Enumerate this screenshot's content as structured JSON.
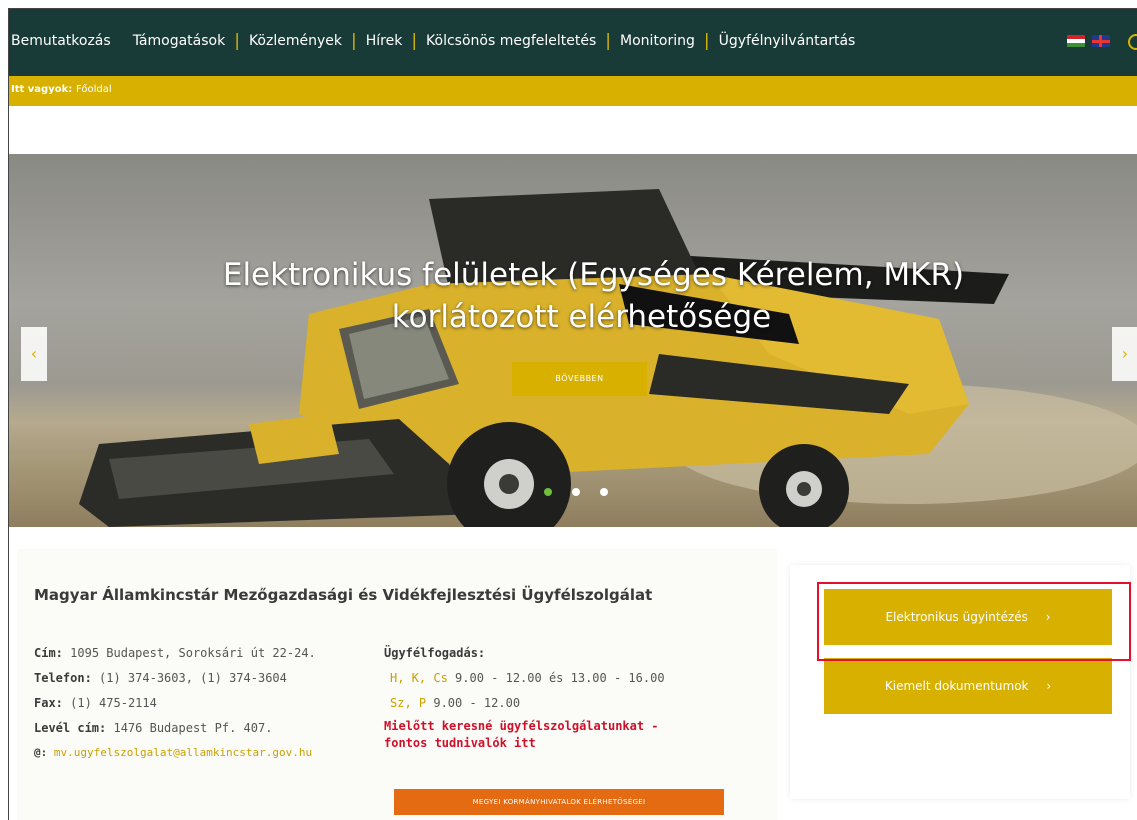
{
  "nav": {
    "items": [
      "Bemutatkozás",
      "Támogatások",
      "Közlemények",
      "Hírek",
      "Kölcsönös megfeleltetés",
      "Monitoring",
      "Ügyfélnyilvántartás"
    ]
  },
  "breadcrumb": {
    "label": "Itt vagyok:",
    "current": "Főoldal"
  },
  "hero": {
    "title_line1": "Elektronikus felületek (Egységes Kérelem, MKR)",
    "title_line2": "korlátozott elérhetősége",
    "button": "BŐVEBBEN",
    "prev_icon": "‹",
    "next_icon": "›",
    "slide_count": 3,
    "active_slide": 1
  },
  "info": {
    "title": "Magyar Államkincstár Mezőgazdasági és Vidékfejlesztési Ügyfélszolgálat",
    "address_label": "Cím:",
    "address": "1095 Budapest, Soroksári út 22-24.",
    "phone_label": "Telefon:",
    "phone": "(1) 374-3603, (1) 374-3604",
    "fax_label": "Fax:",
    "fax": "(1) 475-2114",
    "mail_label": "Levél cím:",
    "mail": "1476 Budapest Pf. 407.",
    "email_label": "@:",
    "email": "mv.ugyfelszolgalat@allamkincstar.gov.hu",
    "hours_label": "Ügyfélfogadás:",
    "hours1_days": "H, K, Cs",
    "hours1": "9.00 - 12.00 és 13.00 - 16.00",
    "hours2_days": "Sz, P",
    "hours2": "9.00 - 12.00",
    "warning_line1": "Mielőtt keresné ügyfélszolgálatunkat -",
    "warning_line2": "fontos tudnivalók itt",
    "county_button": "MEGYEI KORMÁNYHIVATALOK ELÉRHETŐSÉGEI"
  },
  "side": {
    "btn1": "Elektronikus ügyintézés",
    "btn2": "Kiemelt dokumentumok",
    "arrow": "›"
  },
  "colors": {
    "nav_bg": "#183b37",
    "accent": "#d8b100",
    "orange": "#e46b12",
    "highlight": "#e2102a"
  }
}
